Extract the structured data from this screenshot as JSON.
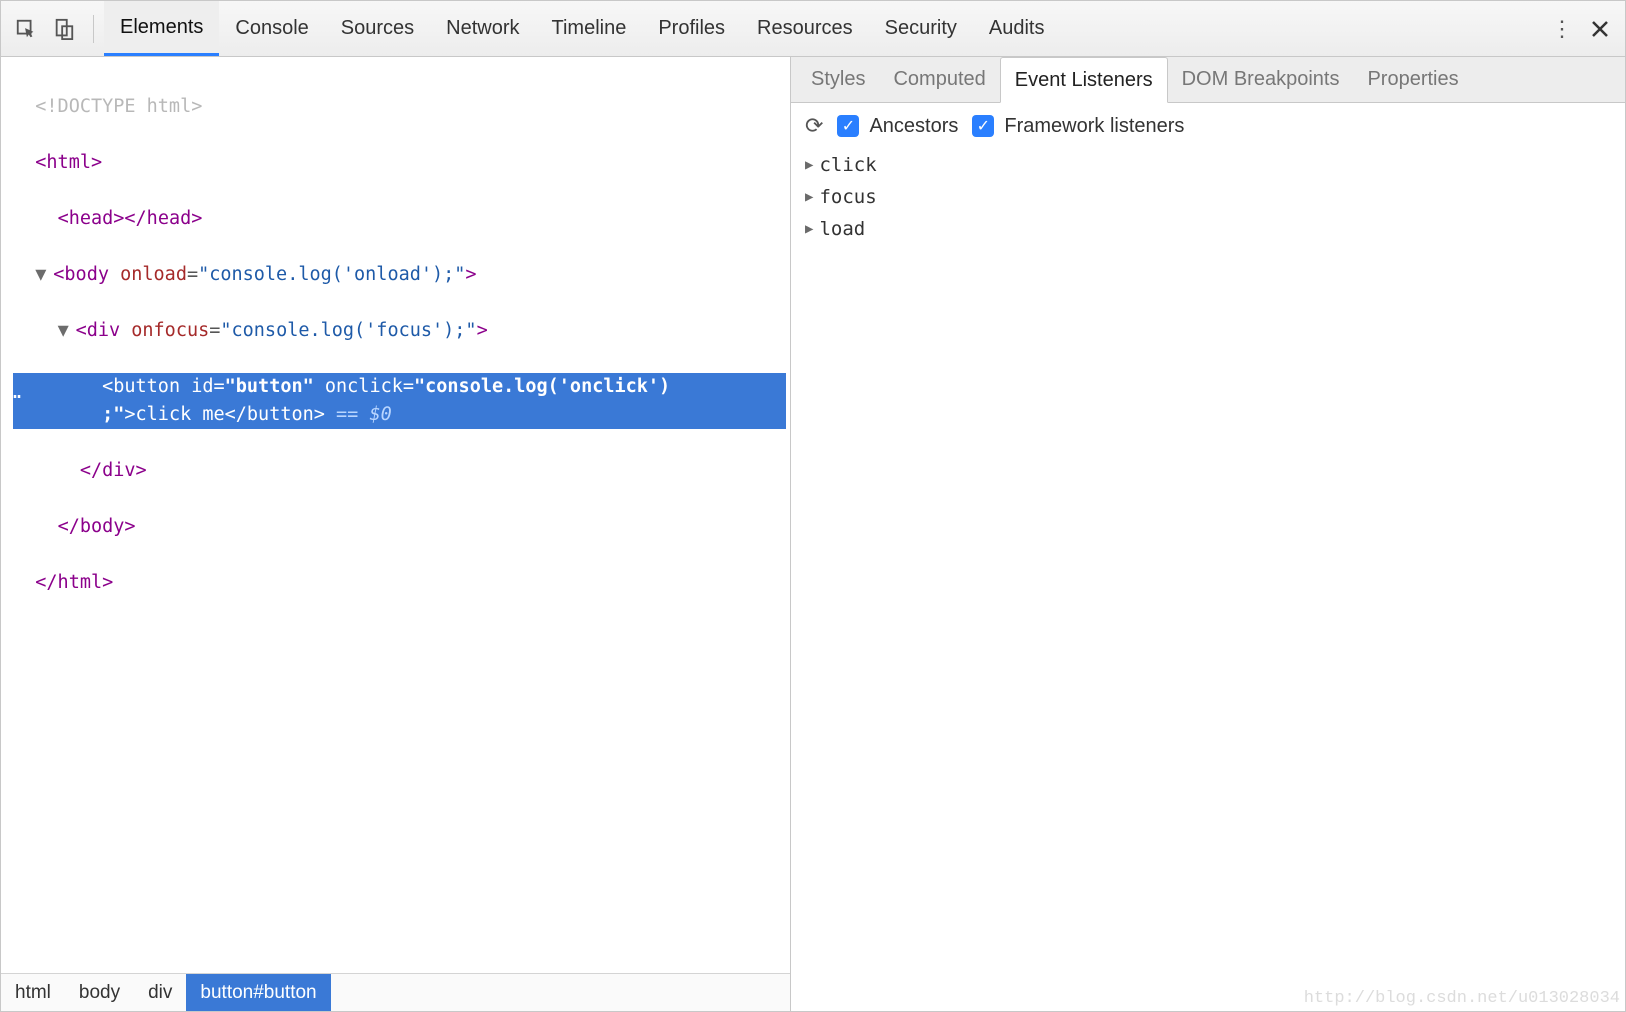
{
  "topTabs": {
    "items": [
      "Elements",
      "Console",
      "Sources",
      "Network",
      "Timeline",
      "Profiles",
      "Resources",
      "Security",
      "Audits"
    ],
    "activeIndex": 0
  },
  "dom": {
    "line0": "<!DOCTYPE html>",
    "html_open": "html",
    "head_open": "head",
    "head_close": "/head",
    "body_tag": "body",
    "body_attr": "onload",
    "body_val": "\"console.log('onload');\"",
    "div_tag": "div",
    "div_attr": "onfocus",
    "div_val": "\"console.log('focus');\"",
    "btn_tag": "button",
    "btn_id_attr": "id",
    "btn_id_val": "\"button\"",
    "btn_onclick_attr": "onclick",
    "btn_onclick_val": "\"console.log('onclick')",
    "btn_onclick_val_cont": ";\"",
    "btn_text": "click me",
    "btn_close": "/button",
    "ref": " == $0",
    "div_close": "/div",
    "body_close": "/body",
    "html_close": "/html"
  },
  "breadcrumb": [
    "html",
    "body",
    "div",
    "button#button"
  ],
  "sideTabs": {
    "items": [
      "Styles",
      "Computed",
      "Event Listeners",
      "DOM Breakpoints",
      "Properties"
    ],
    "activeIndex": 2
  },
  "toolbar": {
    "ancestors": "Ancestors",
    "framework": "Framework listeners"
  },
  "events": [
    "click",
    "focus",
    "load"
  ],
  "watermark": "http://blog.csdn.net/u013028034"
}
